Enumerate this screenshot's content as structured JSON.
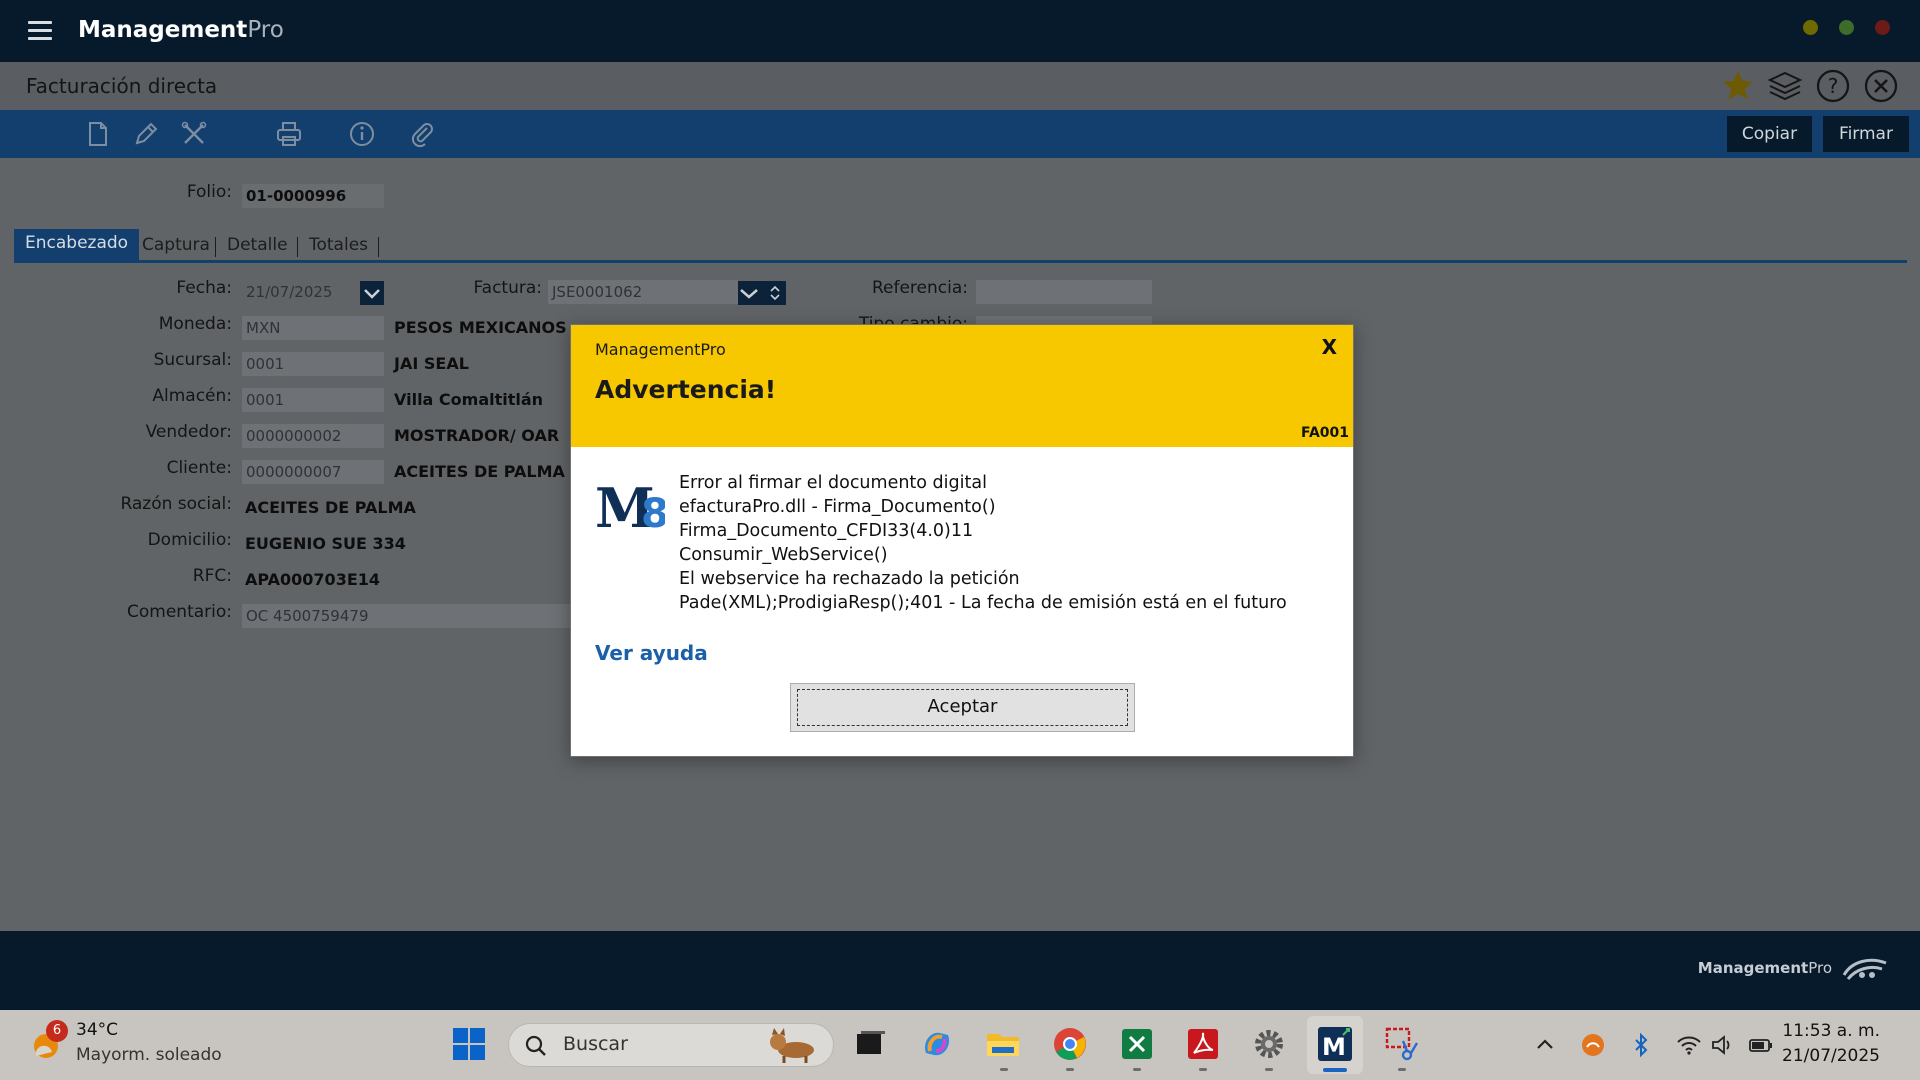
{
  "app": {
    "brand_bold": "Management",
    "brand_light": "Pro"
  },
  "page": {
    "title": "Facturación directa"
  },
  "toolbar": {
    "copy_label": "Copiar",
    "sign_label": "Firmar"
  },
  "form": {
    "folio_label": "Folio:",
    "folio_value": "01-0000996",
    "tabs": [
      "Encabezado",
      "Captura",
      "Detalle",
      "Totales"
    ],
    "fecha_label": "Fecha:",
    "fecha_value": "21/07/2025",
    "factura_label": "Factura:",
    "factura_value": "JSE0001062",
    "referencia_label": "Referencia:",
    "tipo_cambio_label": "Tipo cambio:",
    "moneda_label": "Moneda:",
    "moneda_code": "MXN",
    "moneda_name": "PESOS MEXICANOS",
    "sucursal_label": "Sucursal:",
    "sucursal_code": "0001",
    "sucursal_name": "JAI SEAL",
    "almacen_label": "Almacén:",
    "almacen_code": "0001",
    "almacen_name": "Villa Comaltitlán",
    "vendedor_label": "Vendedor:",
    "vendedor_code": "0000000002",
    "vendedor_name": "MOSTRADOR/ OAR",
    "cliente_label": "Cliente:",
    "cliente_code": "0000000007",
    "cliente_name": "ACEITES DE PALMA",
    "razon_label": "Razón social:",
    "razon_value": "ACEITES DE PALMA",
    "domicilio_label": "Domicilio:",
    "domicilio_value": "EUGENIO SUE 334",
    "rfc_label": "RFC:",
    "rfc_value": "APA000703E14",
    "comentario_label": "Comentario:",
    "comentario_value": "OC 4500759479"
  },
  "dialog": {
    "app_name": "ManagementPro",
    "title": "Advertencia!",
    "close_label": "X",
    "code": "FA001",
    "logo_text": "M8",
    "message_lines": [
      "Error al firmar el documento digital",
      "efacturaPro.dll - Firma_Documento()",
      "Firma_Documento_CFDI33(4.0)11",
      "Consumir_WebService()",
      "El webservice ha rechazado la petición",
      "Pade(XML);ProdigiaResp();401 - La fecha de emisión está en el futuro"
    ],
    "help_link": "Ver ayuda",
    "ok_label": "Aceptar"
  },
  "footer": {
    "brand_bold": "Management",
    "brand_light": "Pro"
  },
  "taskbar": {
    "weather_badge": "6",
    "weather_temp": "34°C",
    "weather_desc": "Mayorm. soleado",
    "search_placeholder": "Buscar",
    "clock_time": "11:53 a. m.",
    "clock_date": "21/07/2025"
  },
  "colors": {
    "accent": "#123f6e",
    "dialog_header": "#f7c800",
    "titlebar": "#061a2b"
  }
}
